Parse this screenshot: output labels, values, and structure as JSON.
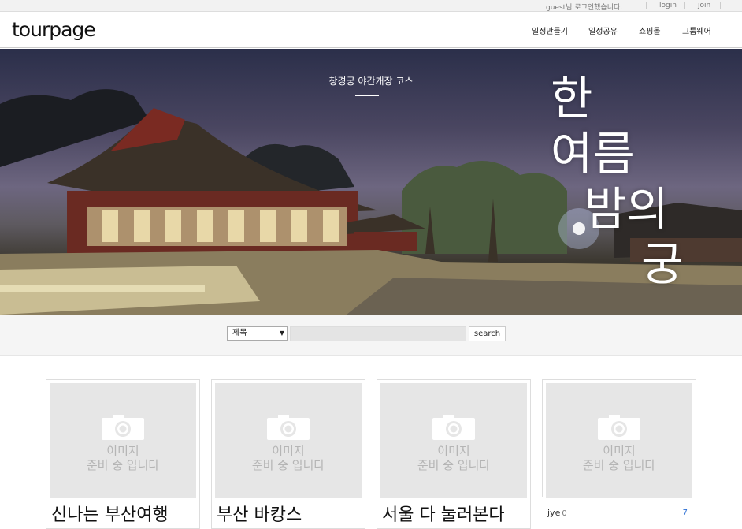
{
  "topbar": {
    "greeting": "guest님 로그인했습니다.",
    "login": "login",
    "join": "join"
  },
  "header": {
    "logo": "tourpage",
    "nav": [
      "일정만들기",
      "일정공유",
      "쇼핑몰",
      "그룹웨어"
    ]
  },
  "hero": {
    "subtitle": "창경궁 야간개장 코스",
    "title_lines": [
      "한",
      "여름",
      "밤의",
      "궁"
    ]
  },
  "search": {
    "select_value": "제목",
    "input_value": "",
    "button_label": "search"
  },
  "cards": [
    {
      "placeholder_line1": "이미지",
      "placeholder_line2": "준비 중 입니다",
      "title": "신나는 부산여행"
    },
    {
      "placeholder_line1": "이미지",
      "placeholder_line2": "준비 중 입니다",
      "title": "부산 바캉스"
    },
    {
      "placeholder_line1": "이미지",
      "placeholder_line2": "준비 중 입니다",
      "title": "서울 다 눌러본다"
    },
    {
      "placeholder_line1": "이미지",
      "placeholder_line2": "준비 중 입니다",
      "user": "jye",
      "count": "0",
      "number": "7"
    }
  ],
  "colors": {
    "accent_blue": "#2a6ed4",
    "placeholder_bg": "#e6e6e6"
  }
}
